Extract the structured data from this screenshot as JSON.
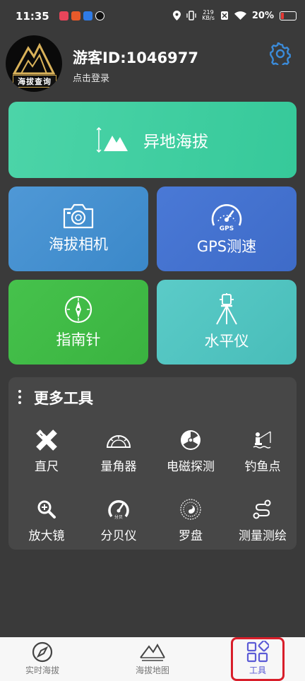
{
  "status": {
    "time": "11:35",
    "speed_value": "219",
    "speed_unit": "KB/s",
    "battery": "20%"
  },
  "header": {
    "logo_text": "海拔查询",
    "username": "游客ID:1046977",
    "login": "点击登录"
  },
  "cards": {
    "remote_altitude": "异地海拔",
    "camera": "海拔相机",
    "gps": "GPS测速",
    "gps_icon_text": "GPS",
    "compass": "指南针",
    "level": "水平仪"
  },
  "more_tools": {
    "title": "更多工具",
    "items": [
      {
        "label": "直尺",
        "icon": "ruler-icon"
      },
      {
        "label": "量角器",
        "icon": "protractor-icon"
      },
      {
        "label": "电磁探测",
        "icon": "radiation-icon"
      },
      {
        "label": "钓鱼点",
        "icon": "fishing-icon"
      },
      {
        "label": "放大镜",
        "icon": "magnifier-icon"
      },
      {
        "label": "分贝仪",
        "icon": "decibel-meter-icon"
      },
      {
        "label": "罗盘",
        "icon": "luopan-icon"
      },
      {
        "label": "测量测绘",
        "icon": "route-icon"
      }
    ],
    "decibel_icon_text": "分贝"
  },
  "nav": {
    "items": [
      {
        "label": "实时海拔",
        "icon": "compass-icon"
      },
      {
        "label": "海拔地图",
        "icon": "mountain-map-icon"
      },
      {
        "label": "工具",
        "icon": "tools-grid-icon"
      }
    ],
    "active": "工具"
  },
  "colors": {
    "background": "#3a3a3a",
    "big_card": "#3fcf9f",
    "camera_card": "#4590cf",
    "gps_card": "#4472cf",
    "compass_card": "#40bb46",
    "level_card": "#52c4c0",
    "settings": "#3b8bd9",
    "nav_active": "#5b5bd6",
    "highlight_frame": "#d81e2a"
  }
}
